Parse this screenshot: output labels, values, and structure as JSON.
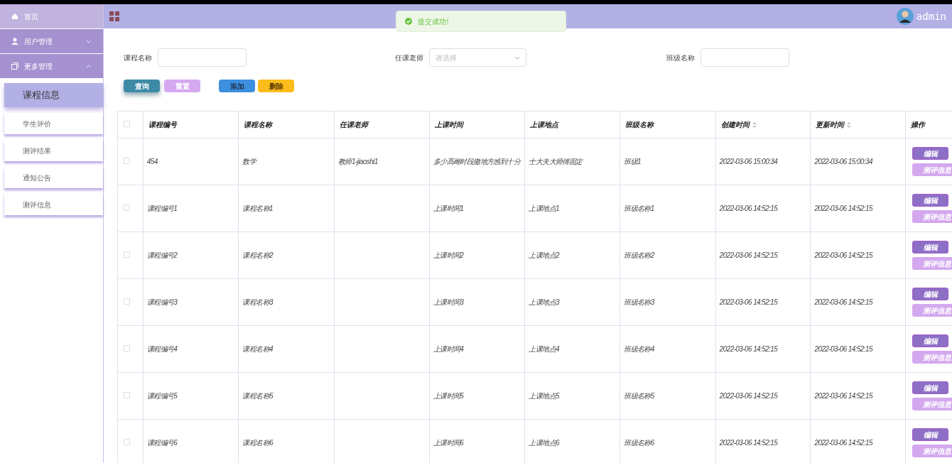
{
  "sidebar": {
    "items": [
      {
        "label": "首页",
        "kind": "home"
      },
      {
        "label": "用户管理",
        "kind": "users",
        "expanded": false
      },
      {
        "label": "更多管理",
        "kind": "more",
        "expanded": true,
        "children": [
          {
            "label": "课程信息",
            "selected": true
          },
          {
            "label": "学生评价",
            "selected": false
          },
          {
            "label": "测评结果",
            "selected": false
          },
          {
            "label": "通知公告",
            "selected": false
          },
          {
            "label": "测评信息",
            "selected": false
          }
        ]
      }
    ]
  },
  "header": {
    "user": "admin"
  },
  "toast": {
    "message": "提交成功!"
  },
  "filters": [
    {
      "label": "课程名称",
      "kind": "text"
    },
    {
      "label": "任课老师",
      "kind": "select",
      "placeholder": "请选择"
    },
    {
      "label": "班级名称",
      "kind": "text"
    }
  ],
  "actions": [
    {
      "label": "查询",
      "kind": "search"
    },
    {
      "label": "重置",
      "kind": "reset"
    },
    {
      "label": "添加",
      "kind": "add"
    },
    {
      "label": "删除",
      "kind": "delete"
    }
  ],
  "table": {
    "all_checked": false,
    "columns": [
      {
        "label": "课程编号",
        "sortable": false
      },
      {
        "label": "课程名称",
        "sortable": false
      },
      {
        "label": "任课老师",
        "sortable": false
      },
      {
        "label": "上课时间",
        "sortable": false
      },
      {
        "label": "上课地点",
        "sortable": false
      },
      {
        "label": "班级名称",
        "sortable": false
      },
      {
        "label": "创建时间",
        "sortable": true
      },
      {
        "label": "更新时间",
        "sortable": true
      },
      {
        "label": "操作",
        "sortable": false
      }
    ],
    "rows": [
      {
        "checked": false,
        "cells": [
          "454",
          "数学",
          "教师1-jiaoshi1",
          "多少髙雌时段撒地方感到十分",
          "士大夫大师傅固定",
          "班级1",
          "2022-03-06 15:00:34",
          "2022-03-06 15:00:34"
        ],
        "buttons": [
          "编辑",
          "测评信息"
        ]
      },
      {
        "checked": false,
        "cells": [
          "课程编号1",
          "课程名称1",
          "",
          "上课时间1",
          "上课地点1",
          "班级名称1",
          "2022-03-06 14:52:15",
          "2022-03-06 14:52:15"
        ],
        "buttons": [
          "编辑",
          "测评信息"
        ]
      },
      {
        "checked": false,
        "cells": [
          "课程编号2",
          "课程名称2",
          "",
          "上课时间2",
          "上课地点2",
          "班级名称2",
          "2022-03-06 14:52:15",
          "2022-03-06 14:52:15"
        ],
        "buttons": [
          "编辑",
          "测评信息"
        ]
      },
      {
        "checked": false,
        "cells": [
          "课程编号3",
          "课程名称3",
          "",
          "上课时间3",
          "上课地点3",
          "班级名称3",
          "2022-03-06 14:52:15",
          "2022-03-06 14:52:15"
        ],
        "buttons": [
          "编辑",
          "测评信息"
        ]
      },
      {
        "checked": false,
        "cells": [
          "课程编号4",
          "课程名称4",
          "",
          "上课时间4",
          "上课地点4",
          "班级名称4",
          "2022-03-06 14:52:15",
          "2022-03-06 14:52:15"
        ],
        "buttons": [
          "编辑",
          "测评信息"
        ]
      },
      {
        "checked": false,
        "cells": [
          "课程编号5",
          "课程名称5",
          "",
          "上课时间5",
          "上课地点5",
          "班级名称5",
          "2022-03-06 14:52:15",
          "2022-03-06 14:52:15"
        ],
        "buttons": [
          "编辑",
          "测评信息"
        ]
      },
      {
        "checked": false,
        "cells": [
          "课程编号6",
          "课程名称6",
          "",
          "上课时间6",
          "上课地点6",
          "班级名称6",
          "2022-03-06 14:52:15",
          "2022-03-06 14:52:15"
        ],
        "buttons": [
          "编辑",
          "测评信息"
        ]
      }
    ]
  }
}
